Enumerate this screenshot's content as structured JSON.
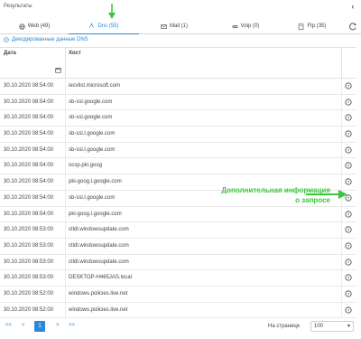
{
  "header": {
    "title": "Результаты",
    "collapse_icon": "chevron-left-icon"
  },
  "tabs": [
    {
      "label": "Web (49)",
      "icon": "globe-icon"
    },
    {
      "label": "Dns (55)",
      "icon": "route-icon",
      "active": true
    },
    {
      "label": "Mail (1)",
      "icon": "mail-icon"
    },
    {
      "label": "Voip (0)",
      "icon": "voip-icon"
    },
    {
      "label": "Ftp (35)",
      "icon": "ftp-icon"
    }
  ],
  "refresh_icon": "refresh-icon",
  "decoded_link": "Декодированные данные DNS",
  "table": {
    "columns": [
      "Дата",
      "Хост"
    ],
    "rows": [
      {
        "date": "30.10.2020 08:54:00",
        "host": "iecvlist.microsoft.com"
      },
      {
        "date": "30.10.2020 08:54:00",
        "host": "sb-ssl.google.com"
      },
      {
        "date": "30.10.2020 08:54:00",
        "host": "sb-ssl.google.com"
      },
      {
        "date": "30.10.2020 08:54:00",
        "host": "sb-ssl.l.google.com"
      },
      {
        "date": "30.10.2020 08:54:00",
        "host": "sb-ssl.l.google.com"
      },
      {
        "date": "30.10.2020 08:54:00",
        "host": "ocsp.pki.goog"
      },
      {
        "date": "30.10.2020 08:54:00",
        "host": "pki-goog.l.google.com"
      },
      {
        "date": "30.10.2020 08:54:00",
        "host": "sb-ssl.l.google.com"
      },
      {
        "date": "30.10.2020 08:54:00",
        "host": "pki-goog.l.google.com"
      },
      {
        "date": "30.10.2020 08:53:00",
        "host": "ctldl.windowsupdate.com"
      },
      {
        "date": "30.10.2020 08:53:00",
        "host": "ctldl.windowsupdate.com"
      },
      {
        "date": "30.10.2020 08:53:00",
        "host": "ctldl.windowsupdate.com"
      },
      {
        "date": "30.10.2020 08:53:00",
        "host": "DESKTOP-H465JAS.local"
      },
      {
        "date": "30.10.2020 08:52:00",
        "host": "windows.policies.live.net"
      },
      {
        "date": "30.10.2020 08:52:00",
        "host": "windows.policies.live.net"
      }
    ]
  },
  "pager": {
    "first": "<<",
    "prev": "<",
    "current": "1",
    "next": ">",
    "last": ">>",
    "per_page_label": "На странице",
    "per_page_value": "100"
  },
  "annotation": {
    "line1": "Дополнительная информация",
    "line2": "о запросе",
    "color": "#3cc43c"
  },
  "accent_color": "#2b8ad8"
}
